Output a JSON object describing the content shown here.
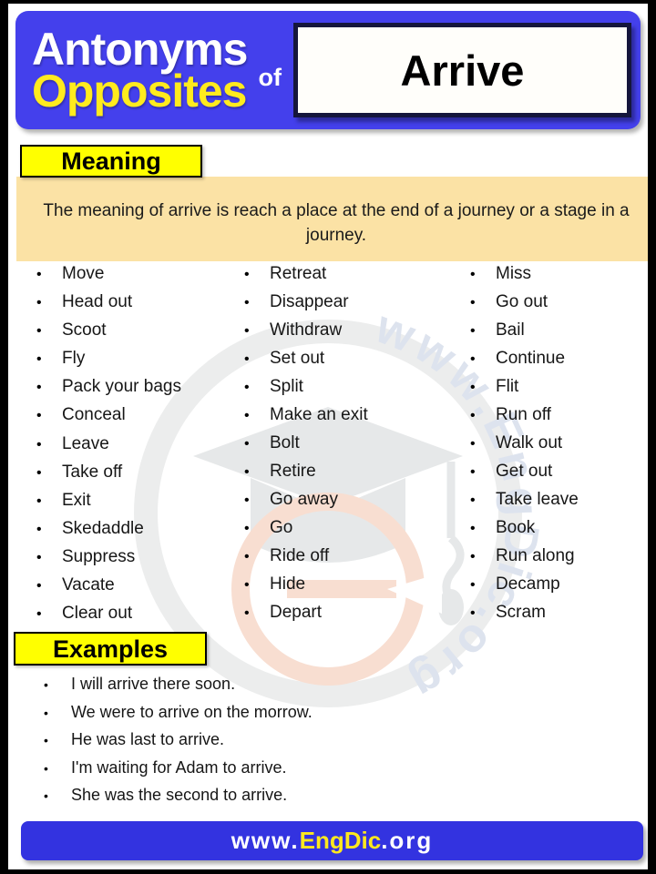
{
  "header": {
    "line1": "Antonyms",
    "line2": "Opposites",
    "connector": "of",
    "word": "Arrive",
    "band_color": "#4440EC",
    "line1_color": "#FFFFFF",
    "line2_color": "#FFEB1E"
  },
  "meaning": {
    "tag_label": "Meaning",
    "text": "The meaning of arrive is reach a place at the end of a journey or a stage in a journey.",
    "panel_color": "#FBE2A5",
    "tag_color": "#FFFF00"
  },
  "antonyms": {
    "columns": [
      {
        "items": [
          "Move",
          "Head out",
          "Scoot",
          "Fly",
          "Pack your bags",
          "Conceal",
          "Leave",
          "Take off",
          "Exit",
          "Skedaddle",
          "Suppress",
          "Vacate",
          "Clear out"
        ]
      },
      {
        "items": [
          "Retreat",
          "Disappear",
          "Withdraw",
          "Set out",
          "Split",
          "Make an exit",
          "Bolt",
          "Retire",
          "Go away",
          "Go",
          "Ride off",
          "Hide",
          "Depart"
        ]
      },
      {
        "items": [
          "Miss",
          "Go out",
          "Bail",
          "Continue",
          "Flit",
          "Run off",
          "Walk out",
          "Get out",
          "Take leave",
          "Book",
          "Run along",
          "Decamp",
          "Scram"
        ]
      }
    ],
    "bullet": "•"
  },
  "examples": {
    "tag_label": "Examples",
    "items": [
      "I will arrive there soon.",
      "We were to arrive on the morrow.",
      "He was last to arrive.",
      "I'm waiting for Adam to arrive.",
      "She was the second to arrive."
    ],
    "bullet": "•"
  },
  "footer": {
    "prefix": "www.",
    "brand": "EngDic",
    "suffix": ".org",
    "band_color": "#3333E0",
    "brand_color": "#FFE81E"
  },
  "watermark": {
    "ring_text": "www.EngDic.org"
  }
}
